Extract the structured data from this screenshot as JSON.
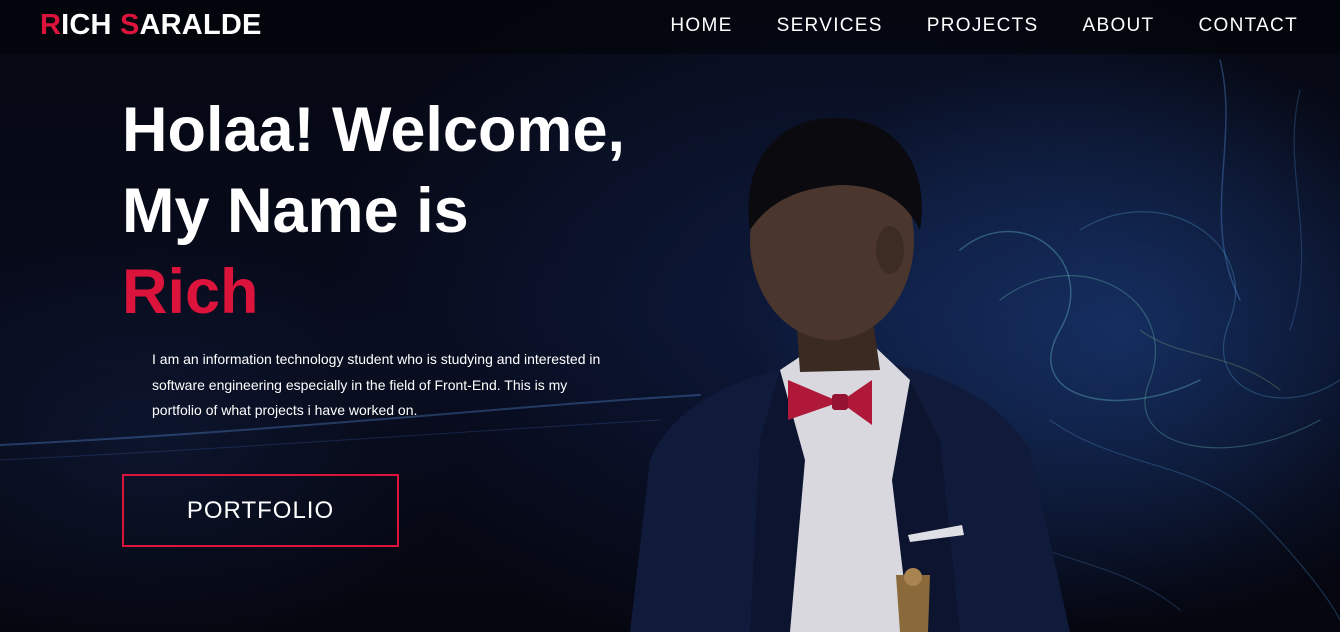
{
  "brand": {
    "first_initial": "R",
    "first_rest": "ICH ",
    "last_initial": "S",
    "last_rest": "ARALDE",
    "accent_color": "#dc143c"
  },
  "nav": {
    "items": [
      {
        "label": "HOME"
      },
      {
        "label": "SERVICES"
      },
      {
        "label": "PROJECTS"
      },
      {
        "label": "ABOUT"
      },
      {
        "label": "CONTACT"
      }
    ]
  },
  "hero": {
    "line1": "Holaa! Welcome,",
    "line2": "My Name is",
    "name": "Rich",
    "bio": "I am an information technology student who is studying and interested in software engineering especially in the field of Front-End. This is my portfolio of what projects i have worked on.",
    "cta_label": "PORTFOLIO"
  },
  "colors": {
    "background": "#05060f",
    "text": "#ffffff",
    "accent": "#dc143c"
  }
}
